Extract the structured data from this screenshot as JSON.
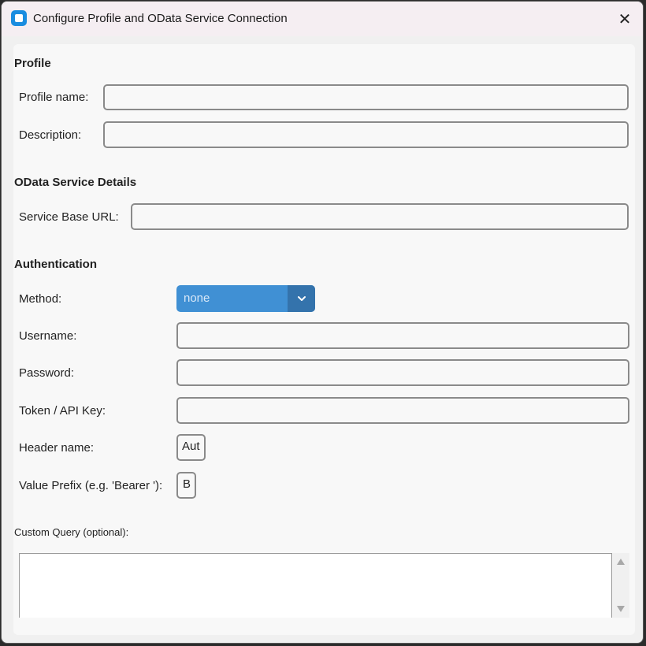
{
  "window": {
    "title": "Configure Profile and OData Service Connection",
    "close_glyph": "✕"
  },
  "profile": {
    "heading": "Profile",
    "name_label": "Profile name:",
    "name_value": "",
    "description_label": "Description:",
    "description_value": ""
  },
  "odata": {
    "heading": "OData Service Details",
    "base_url_label": "Service Base URL:",
    "base_url_value": ""
  },
  "auth": {
    "heading": "Authentication",
    "method_label": "Method:",
    "method_value": "none",
    "username_label": "Username:",
    "username_value": "",
    "password_label": "Password:",
    "password_value": "",
    "token_label": "Token / API Key:",
    "token_value": "",
    "header_name_label": "Header name:",
    "header_name_value": "Aut",
    "value_prefix_label": "Value Prefix (e.g. 'Bearer '):",
    "value_prefix_value": "B"
  },
  "custom_query": {
    "label": "Custom Query (optional):",
    "value": ""
  },
  "colors": {
    "combo_bg": "#4090d4",
    "combo_arrow_bg": "#3473ac",
    "app_icon": "#1a8de0"
  }
}
